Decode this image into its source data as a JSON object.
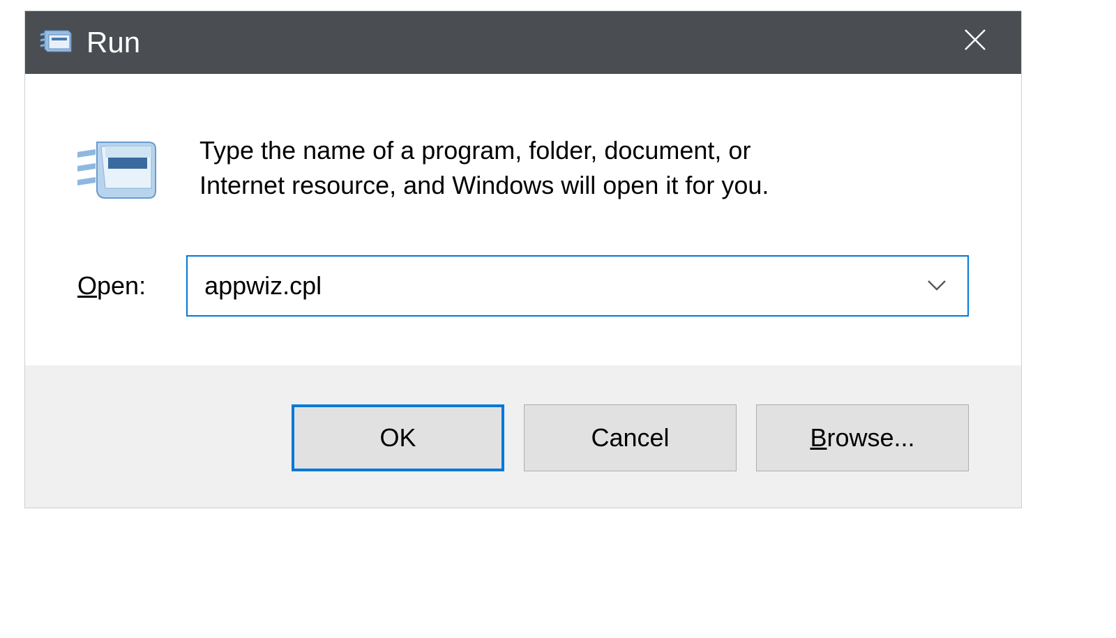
{
  "titlebar": {
    "title": "Run",
    "close_label": "Close"
  },
  "content": {
    "description": "Type the name of a program, folder, document, or Internet resource, and Windows will open it for you.",
    "open_label_underlined": "O",
    "open_label_rest": "pen:",
    "input_value": "appwiz.cpl"
  },
  "buttons": {
    "ok": "OK",
    "cancel": "Cancel",
    "browse_underlined": "B",
    "browse_rest": "rowse..."
  },
  "icons": {
    "run_small": "run-icon",
    "run_large": "run-icon",
    "chevron": "chevron-down-icon",
    "close": "close-icon"
  }
}
